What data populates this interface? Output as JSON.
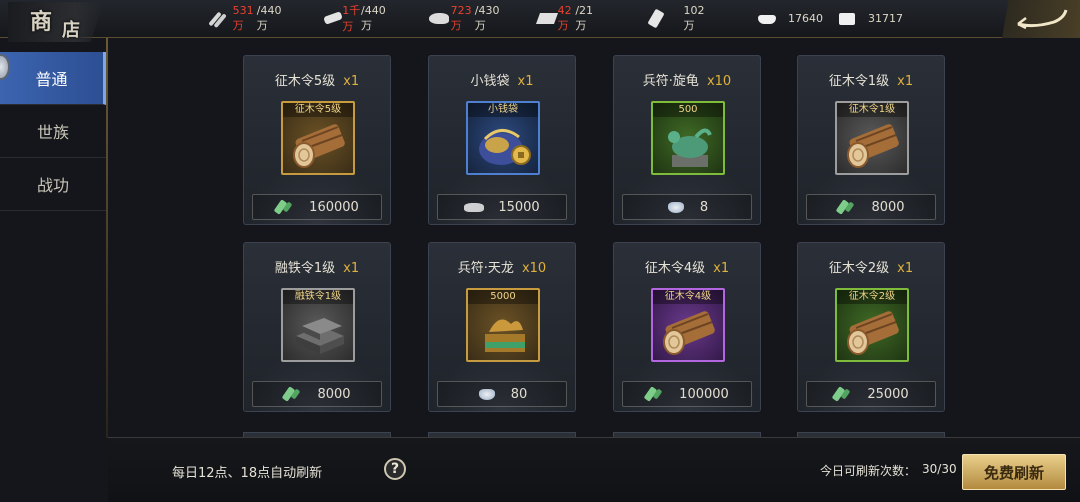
{
  "header": {
    "title_chars": [
      "商",
      "店"
    ],
    "resources": [
      {
        "icon": "grain-icon",
        "current": "531万",
        "cap": "/440万",
        "over": true
      },
      {
        "icon": "wood-icon",
        "current": "1千万",
        "cap": "/440万",
        "over": true
      },
      {
        "icon": "stone-icon",
        "current": "723万",
        "cap": "/430万",
        "over": true
      },
      {
        "icon": "iron-icon",
        "current": "42万",
        "cap": "/21万",
        "over": true
      },
      {
        "icon": "military-token-icon",
        "current": "102万",
        "cap": "",
        "over": false
      },
      {
        "icon": "gold-ingot-icon",
        "current": "17640",
        "cap": "",
        "over": false
      },
      {
        "icon": "silver-ingot-icon",
        "current": "31717",
        "cap": "",
        "over": false
      }
    ]
  },
  "sidebar": {
    "tabs": [
      {
        "label": "普通",
        "active": true
      },
      {
        "label": "世族",
        "active": false
      },
      {
        "label": "战功",
        "active": false
      }
    ]
  },
  "items": [
    {
      "name": "征木令5级",
      "qty": "x1",
      "box_label": "征木令5级",
      "quality": "gold",
      "art": "log",
      "cost_icon": "jade-icon",
      "price": "160000"
    },
    {
      "name": "小钱袋",
      "qty": "x1",
      "box_label": "小钱袋",
      "quality": "blue",
      "art": "moneybag",
      "cost_icon": "silver-pile-icon",
      "price": "15000"
    },
    {
      "name": "兵符·旋龟",
      "qty": "x10",
      "box_label": "500",
      "quality": "green",
      "art": "turtle",
      "cost_icon": "ingot-icon",
      "price": "8"
    },
    {
      "name": "征木令1级",
      "qty": "x1",
      "box_label": "征木令1级",
      "quality": "gray",
      "art": "log",
      "cost_icon": "jade-icon",
      "price": "8000"
    },
    {
      "name": "融铁令1级",
      "qty": "x1",
      "box_label": "融铁令1级",
      "quality": "gray",
      "art": "iron",
      "cost_icon": "jade-icon",
      "price": "8000"
    },
    {
      "name": "兵符·天龙",
      "qty": "x10",
      "box_label": "5000",
      "quality": "gold",
      "art": "dragon",
      "cost_icon": "ingot-icon",
      "price": "80"
    },
    {
      "name": "征木令4级",
      "qty": "x1",
      "box_label": "征木令4级",
      "quality": "purple",
      "art": "log",
      "cost_icon": "jade-icon",
      "price": "100000"
    },
    {
      "name": "征木令2级",
      "qty": "x1",
      "box_label": "征木令2级",
      "quality": "green",
      "art": "log",
      "cost_icon": "jade-icon",
      "price": "25000"
    }
  ],
  "footer": {
    "refresh_note": "每日12点、18点自动刷新",
    "help_label": "?",
    "refresh_count_label": "今日可刷新次数：",
    "refresh_count_value": "30/30",
    "free_refresh_label": "免费刷新"
  }
}
